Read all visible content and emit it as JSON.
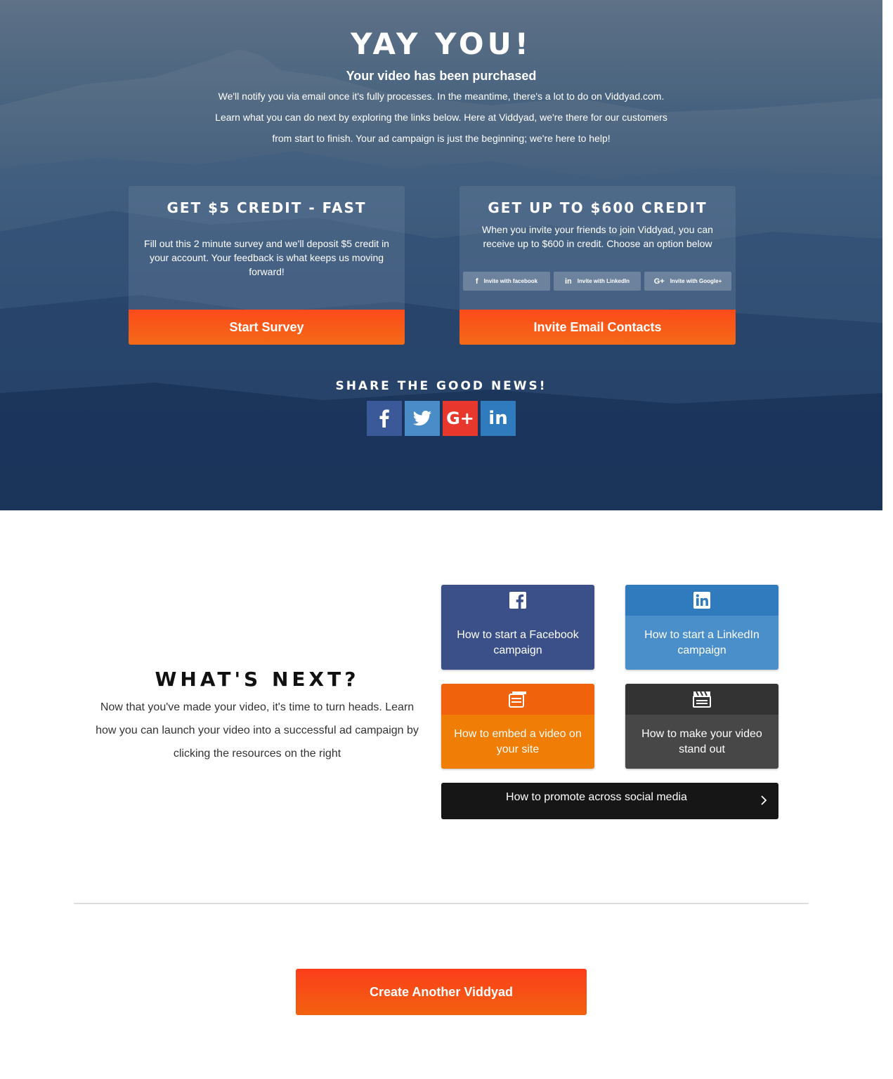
{
  "hero": {
    "title": "YAY YOU!",
    "subtitle": "Your video has been purchased",
    "paragraph": "We'll notify you via email once it's fully processes. In the meantime, there's a lot to do on Viddyad.com. Learn what you can do next by exploring the links below. Here at Viddyad, we're there for our customers from start to finish. Your ad campaign is just the beginning; we're here to help!"
  },
  "survey_card": {
    "title": "GET $5 CREDIT - FAST",
    "text": "Fill out this 2 minute survey and we'll deposit $5 credit in your account. Your feedback is what keeps us moving forward!",
    "button": "Start Survey"
  },
  "invite_card": {
    "title": "GET UP TO $600 CREDIT",
    "text": "When you invite your friends to join Viddyad, you can receive up to $600 in credit. Choose an option below",
    "options": [
      {
        "label": "Invite with facebook",
        "icon": "facebook-icon",
        "glyph": "f"
      },
      {
        "label": "Invite with LinkedIn",
        "icon": "linkedin-icon",
        "glyph": "in"
      },
      {
        "label": "Invite with Google+",
        "icon": "google-plus-icon",
        "glyph": "G+"
      }
    ],
    "button": "Invite Email Contacts"
  },
  "share": {
    "title": "SHARE THE GOOD NEWS!",
    "buttons": [
      {
        "icon": "facebook-icon",
        "color": "#3b5998"
      },
      {
        "icon": "twitter-icon",
        "color": "#4a8cc7"
      },
      {
        "icon": "google-plus-icon",
        "color": "#e8372c"
      },
      {
        "icon": "linkedin-icon",
        "color": "#2f7bbd"
      }
    ]
  },
  "whats_next": {
    "title": "WHAT'S NEXT?",
    "text": "Now that you've made your video, it's time to turn heads. Learn how you can launch your video into a successful ad campaign by clicking the resources on the right"
  },
  "resources": {
    "facebook": "How to start a Facebook campaign",
    "linkedin": "How to start a LinkedIn campaign",
    "embed": "How to embed a video on your site",
    "standout": "How to make your video stand out",
    "promote": "How to promote across social media"
  },
  "create_button": "Create Another Viddyad",
  "colors": {
    "accent": "#fc4a1a",
    "facebook": "#3b5088",
    "linkedin": "#4a8fc9",
    "embed": "#f07d05",
    "standout": "#474747",
    "promote": "#161616"
  }
}
